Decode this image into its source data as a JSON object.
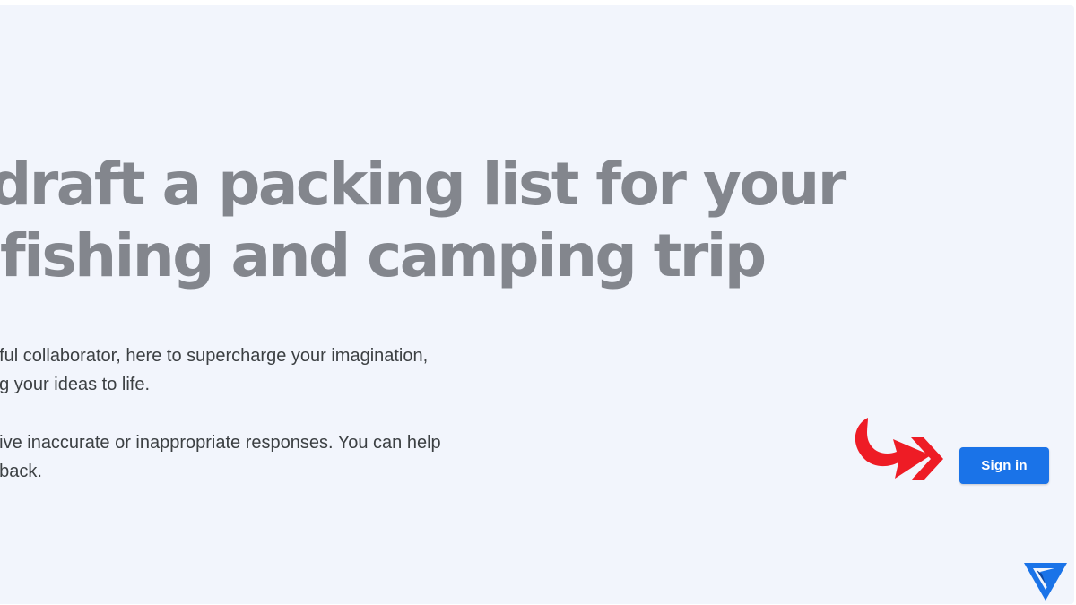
{
  "hero": {
    "headline_lines": [
      "draft a packing list for your",
      "fishing and camping trip"
    ],
    "paragraph_1_lines": [
      "pful collaborator, here to supercharge your imagination,",
      "ng your ideas to life."
    ],
    "paragraph_2_lines": [
      "give inaccurate or inappropriate responses. You can help",
      "dback."
    ]
  },
  "auth": {
    "sign_in_label": "Sign in"
  },
  "annotation": {
    "icon": "red-arrow-icon",
    "color": "#ee1c25"
  },
  "watermark": {
    "icon": "brand-logo-icon",
    "color": "#1a73e8"
  },
  "colors": {
    "background": "#f2f5fc",
    "headline": "#83868d",
    "body_text": "#3c4043",
    "accent": "#1a73e8"
  }
}
